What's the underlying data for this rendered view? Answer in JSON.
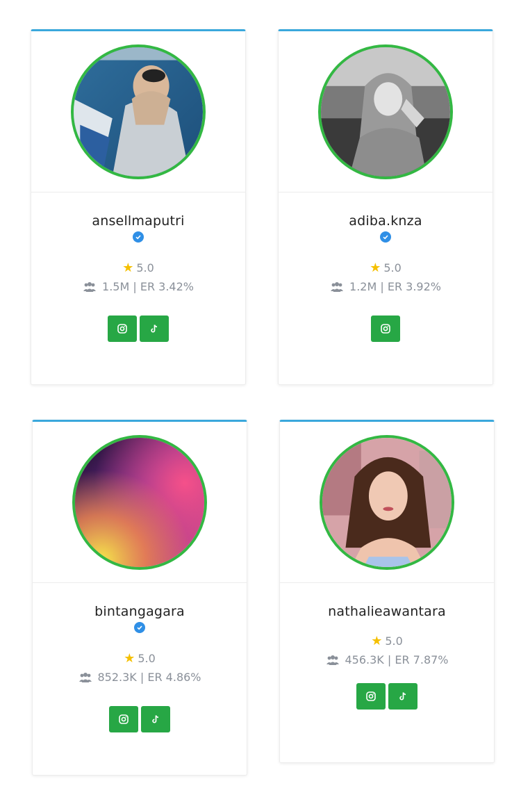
{
  "cards": [
    {
      "username": "ansellmaputri",
      "verified": true,
      "rating": "5.0",
      "stats": "1.5M | ER 3.42%",
      "platforms": [
        "instagram",
        "tiktok"
      ]
    },
    {
      "username": "adiba.knza",
      "verified": true,
      "rating": "5.0",
      "stats": "1.2M | ER 3.92%",
      "platforms": [
        "instagram"
      ]
    },
    {
      "username": "bintangagara",
      "verified": true,
      "rating": "5.0",
      "stats": "852.3K | ER 4.86%",
      "platforms": [
        "instagram",
        "tiktok"
      ]
    },
    {
      "username": "nathalieawantara",
      "verified": false,
      "rating": "5.0",
      "stats": "456.3K | ER 7.87%",
      "platforms": [
        "instagram",
        "tiktok"
      ]
    }
  ],
  "colors": {
    "accent_top": "#3aa8dc",
    "avatar_ring": "#33b843",
    "button": "#27a745",
    "verified": "#2f8fe6",
    "star": "#f5c000"
  },
  "icons": {
    "verified": "check-badge-icon",
    "rating": "star-icon",
    "followers": "users-icon",
    "instagram": "instagram-icon",
    "tiktok": "tiktok-icon"
  }
}
